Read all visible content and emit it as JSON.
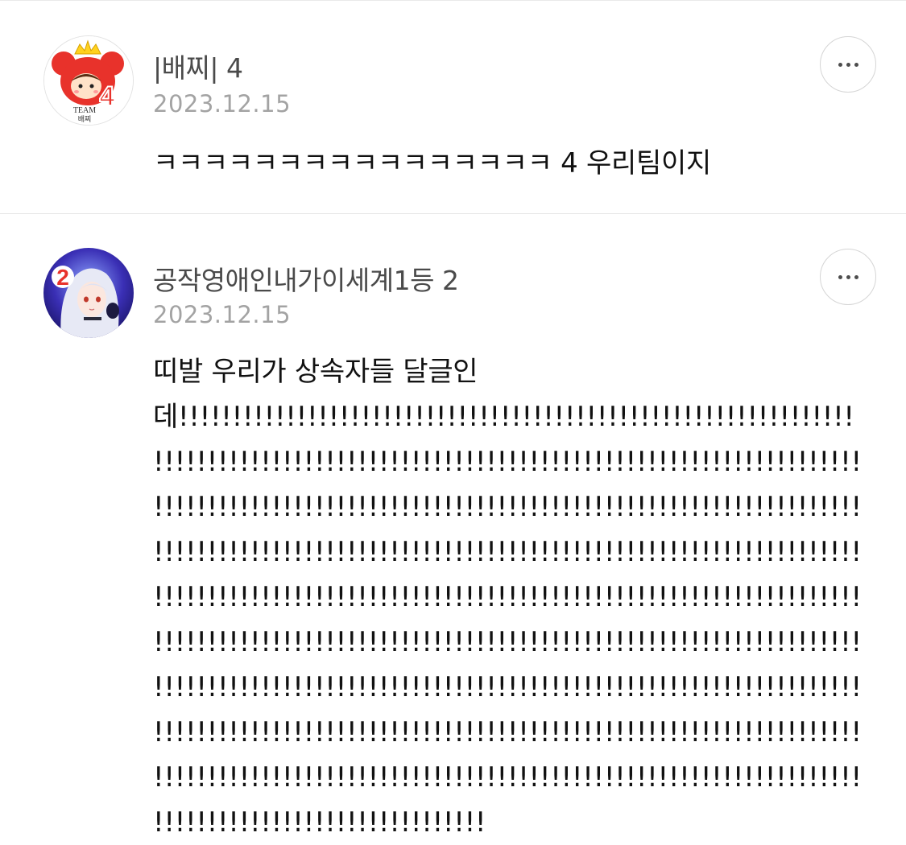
{
  "comments": [
    {
      "author": "|배찌| 4",
      "date": "2023.12.15",
      "text": "ㅋㅋㅋㅋㅋㅋㅋㅋㅋㅋㅋㅋㅋㅋㅋㅋ 4 우리팀이지",
      "avatar": {
        "badge_number": "4",
        "caption_line1": "TEAM",
        "caption_line2": "배찌",
        "badge_color": "#e8322b",
        "crown_color": "#ffd21f"
      }
    },
    {
      "author": "공작영애인내가이세계1등 2",
      "date": "2023.12.15",
      "text": "띠발 우리가 상속자들 달글인 데!!!!!!!!!!!!!!!!!!!!!!!!!!!!!!!!!!!!!!!!!!!!!!!!!!!!!!!!!!!!!!!!!!!!!!!!!!!!!!!!!!!!!!!!!!!!!!!!!!!!!!!!!!!!!!!!!!!!!!!!!!!!!!!!!!!!!!!!!!!!!!!!!!!!!!!!!!!!!!!!!!!!!!!!!!!!!!!!!!!!!!!!!!!!!!!!!!!!!!!!!!!!!!!!!!!!!!!!!!!!!!!!!!!!!!!!!!!!!!!!!!!!!!!!!!!!!!!!!!!!!!!!!!!!!!!!!!!!!!!!!!!!!!!!!!!!!!!!!!!!!!!!!!!!!!!!!!!!!!!!!!!!!!!!!!!!!!!!!!!!!!!!!!!!!!!!!!!!!!!!!!!!!!!!!!!!!!!!!!!!!!!!!!!!!!!!!!!!!!!!!!!!!!!!!!!!!!!!!!!!!!!!!!!!!!!!!!!!!!!!!!!!!!!!!!!!!!!!!!!!!!!!!!!!!!!!!!!!!!!!!!!!!!!!!!!!!!!!!!!!!!!!!!!!!!!!!!!!!!!!!!!!!!!!!!!!!!!!!!!!!!!!!!!!!!!!!!!!!!!!!!!!!!!!!!!!!!!!!!!!!!!!!!!!!!!!!!!!!!!!!!!!!!!!!!!!!!!!!!!!!!",
      "avatar": {
        "badge_number": "2",
        "badge_color": "#e8322b",
        "bg_color": "#3a2fb5"
      }
    }
  ],
  "icons": {
    "more": "more-horizontal-icon"
  }
}
